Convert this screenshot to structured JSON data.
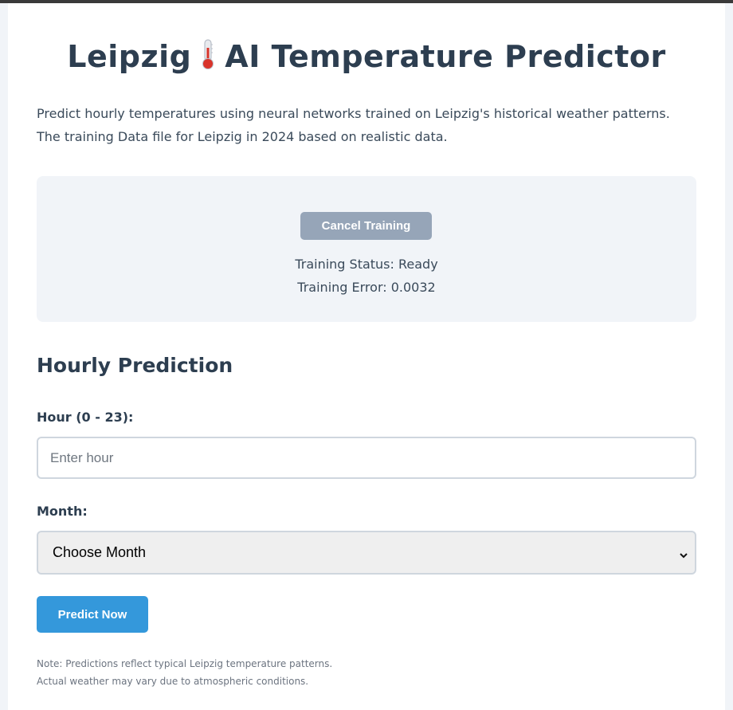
{
  "header": {
    "title_prefix": "Leipzig",
    "title_icon": "thermometer-icon",
    "title_suffix": "AI Temperature Predictor"
  },
  "intro": {
    "line1": "Predict hourly temperatures using neural networks trained on Leipzig's historical weather patterns.",
    "line2": "The training Data file for Leipzig in 2024 based on realistic data."
  },
  "training": {
    "cancel_label": "Cancel Training",
    "status": "Training Status: Ready",
    "error": "Training Error: 0.0032"
  },
  "prediction": {
    "section_title": "Hourly Prediction",
    "hour_label": "Hour (0 - 23):",
    "hour_placeholder": "Enter hour",
    "hour_value": "",
    "month_label": "Month:",
    "month_selected": "Choose Month",
    "predict_label": "Predict Now"
  },
  "note": {
    "line1": "Note: Predictions reflect typical Leipzig temperature patterns.",
    "line2": "Actual weather may vary due to atmospheric conditions."
  },
  "colors": {
    "primary_button": "#3498db",
    "disabled_button": "#96a5b8",
    "heading": "#2d3e50",
    "panel_bg": "#f1f4f8"
  }
}
